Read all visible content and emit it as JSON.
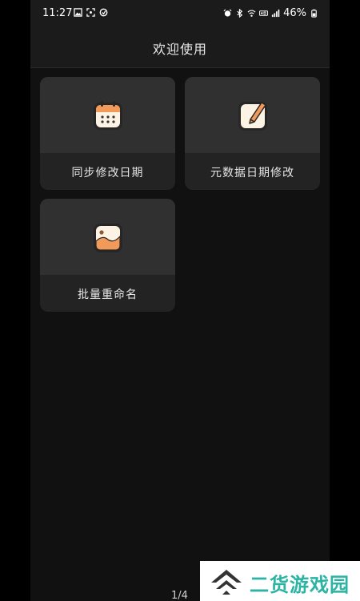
{
  "status_bar": {
    "time": "11:27",
    "battery": "46%",
    "icons_left": [
      "image-icon",
      "screenshot-icon",
      "vpn-icon"
    ],
    "icons_right": [
      "alarm-icon",
      "bluetooth-icon",
      "wifi-icon",
      "hd-icon",
      "signal-icon",
      "battery-icon"
    ]
  },
  "app_bar": {
    "title": "欢迎使用"
  },
  "cards": [
    {
      "label": "同步修改日期",
      "icon": "calendar-icon"
    },
    {
      "label": "元数据日期修改",
      "icon": "edit-note-icon"
    },
    {
      "label": "批量重命名",
      "icon": "photo-icon"
    }
  ],
  "page_indicator": "1/4",
  "watermark": {
    "text": "二货游戏园"
  },
  "colors": {
    "background": "#111111",
    "card": "#232323",
    "card_top": "#303030",
    "accent_orange": "#f29a5a"
  }
}
